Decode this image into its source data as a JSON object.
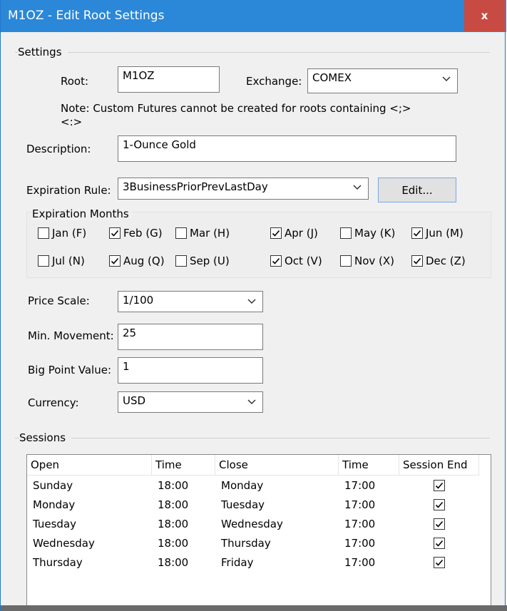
{
  "window": {
    "title": "M1OZ - Edit Root Settings",
    "close_label": "x"
  },
  "settings": {
    "group_title": "Settings",
    "root_label": "Root:",
    "root_value": "M1OZ",
    "exchange_label": "Exchange:",
    "exchange_value": "COMEX",
    "note": "Note: Custom Futures cannot be created for roots containing <;>",
    "note_line2": "<:>",
    "description_label": "Description:",
    "description_value": "1-Ounce Gold",
    "expiration_rule_label": "Expiration Rule:",
    "expiration_rule_value": "3BusinessPriorPrevLastDay",
    "edit_button_label": "Edit..."
  },
  "expiration_months": {
    "title": "Expiration Months",
    "months": [
      {
        "label": "Jan (F)",
        "checked": false
      },
      {
        "label": "Feb (G)",
        "checked": true
      },
      {
        "label": "Mar (H)",
        "checked": false
      },
      {
        "label": "Apr (J)",
        "checked": true
      },
      {
        "label": "May (K)",
        "checked": false
      },
      {
        "label": "Jun (M)",
        "checked": true
      },
      {
        "label": "Jul (N)",
        "checked": false
      },
      {
        "label": "Aug (Q)",
        "checked": true
      },
      {
        "label": "Sep (U)",
        "checked": false
      },
      {
        "label": "Oct (V)",
        "checked": true
      },
      {
        "label": "Nov (X)",
        "checked": false
      },
      {
        "label": "Dec (Z)",
        "checked": true
      }
    ]
  },
  "pricing": {
    "price_scale_label": "Price Scale:",
    "price_scale_value": "1/100",
    "min_movement_label": "Min. Movement:",
    "min_movement_value": "25",
    "big_point_label": "Big Point Value:",
    "big_point_value": "1",
    "currency_label": "Currency:",
    "currency_value": "USD"
  },
  "sessions": {
    "group_title": "Sessions",
    "columns": [
      "Open",
      "Time",
      "Close",
      "Time",
      "Session End"
    ],
    "rows": [
      {
        "open": "Sunday",
        "open_time": "18:00",
        "close": "Monday",
        "close_time": "17:00",
        "session_end": true
      },
      {
        "open": "Monday",
        "open_time": "18:00",
        "close": "Tuesday",
        "close_time": "17:00",
        "session_end": true
      },
      {
        "open": "Tuesday",
        "open_time": "18:00",
        "close": "Wednesday",
        "close_time": "17:00",
        "session_end": true
      },
      {
        "open": "Wednesday",
        "open_time": "18:00",
        "close": "Thursday",
        "close_time": "17:00",
        "session_end": true
      },
      {
        "open": "Thursday",
        "open_time": "18:00",
        "close": "Friday",
        "close_time": "17:00",
        "session_end": true
      }
    ]
  }
}
